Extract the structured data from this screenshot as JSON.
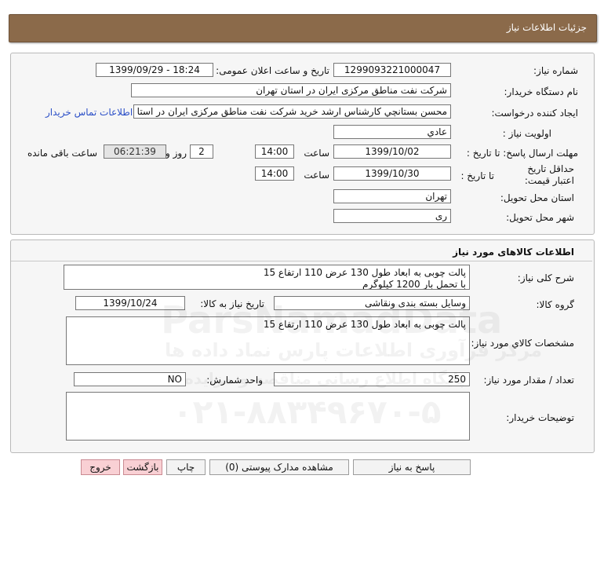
{
  "header": {
    "title": "جزئیات اطلاعات نیاز"
  },
  "info": {
    "need_number_label": "شماره نیاز:",
    "need_number": "1299093221000047",
    "announce_label": "تاریخ و ساعت اعلان عمومی:",
    "announce_value": "1399/09/29 - 18:24",
    "buyer_org_label": "نام دستگاه خریدار:",
    "buyer_org": "شرکت نفت مناطق مرکزی ایران در استان تهران",
    "requester_label": "ایجاد کننده درخواست:",
    "requester": "محسن بستانچي کارشناس ارشد خرید شرکت نفت مناطق مرکزی ایران در استا",
    "contact_link": "اطلاعات تماس خریدار",
    "priority_label": "اولویت نیاز :",
    "priority": "عادي",
    "deadline_label": "مهلت ارسال پاسخ: تا تاریخ :",
    "deadline_date": "1399/10/02",
    "time_label": "ساعت",
    "deadline_time": "14:00",
    "days_value": "2",
    "days_label": "روز و",
    "remaining_time": "06:21:39",
    "remaining_label": "ساعت باقی مانده",
    "validity_label": "حداقل تاریخ اعتبار قیمت:",
    "validity_date_label": "تا تاریخ :",
    "validity_date": "1399/10/30",
    "validity_time_label": "ساعت",
    "validity_time": "14:00",
    "province_label": "استان محل تحویل:",
    "province": "تهران",
    "city_label": "شهر محل تحویل:",
    "city": "ری"
  },
  "goods": {
    "title": "اطلاعات کالاهای مورد نیاز",
    "general_desc_label": "شرح کلی نیاز:",
    "general_desc_line1": "پالت چوبی به ابعاد طول 130 عرض 110 ارتفاع 15",
    "general_desc_line2": "با تحمل بار 1200 کیلوگرم",
    "group_label": "گروه کالا:",
    "group": "وسایل بسته بندی  ونقاشی",
    "need_date_label": "تاریخ نیاز به کالا:",
    "need_date": "1399/10/24",
    "spec_label": "مشخصات کالاي مورد نیاز:",
    "spec": "پالت چوبی به ابعاد طول 130 عرض 110 ارتفاع 15",
    "qty_label": "تعداد / مقدار مورد نیاز:",
    "qty": "250",
    "unit_label": "واحد شمارش:",
    "unit": "NO",
    "buyer_notes_label": "توضیحات خریدار:",
    "buyer_notes": ""
  },
  "buttons": {
    "reply": "پاسخ به نیاز",
    "attachments": "مشاهده مدارک پیوستی (0)",
    "print": "چاپ",
    "back": "بازگشت",
    "exit": "خروج"
  },
  "watermark": {
    "brand": "ParsNamadData",
    "line1": "مرکز فرآوری اطلاعات پارس نماد داده ها",
    "line2": "پایگاه اطلاع رسانی مناقصه و مزایده",
    "phone": "۰۲۱-۸۸۳۴۹۶۷۰-۵"
  }
}
